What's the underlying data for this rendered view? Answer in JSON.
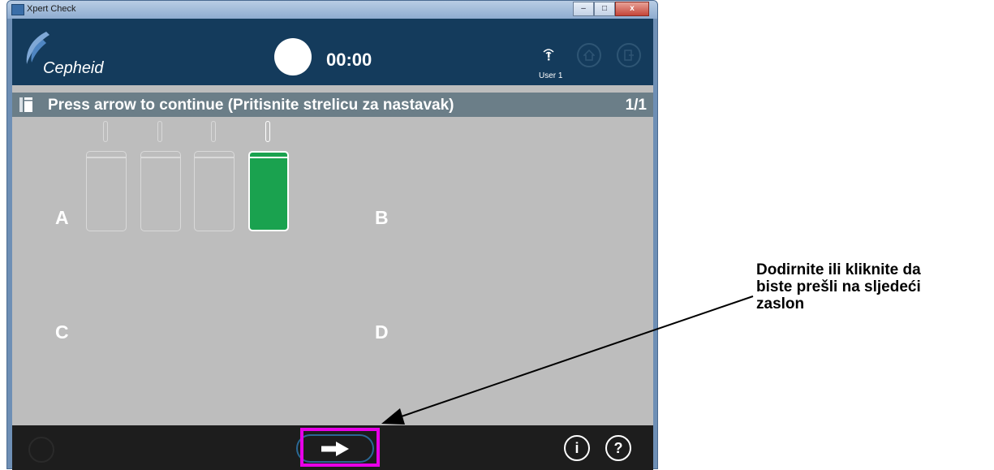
{
  "window": {
    "title": "Xpert Check",
    "minimize_label": "–",
    "maximize_label": "□",
    "close_label": "x"
  },
  "header": {
    "logo_text": "Cepheid",
    "timer": "00:00",
    "user_label": "User 1",
    "icons": [
      "wifi-warning-icon",
      "home-icon",
      "exit-icon"
    ]
  },
  "instruction": {
    "text": "Press arrow to continue (Pritisnite strelicu za nastavak)",
    "page_count": "1/1"
  },
  "modules": {
    "count": 4,
    "active_index": 4
  },
  "quadrants": {
    "a": "A",
    "b": "B",
    "c": "C",
    "d": "D"
  },
  "footer": {
    "info_label": "i",
    "help_label": "?"
  },
  "callout": {
    "line1": "Dodirnite ili kliknite da",
    "line2": "biste prešli na sljedeći",
    "line3": "zaslon"
  },
  "colors": {
    "header_bg": "#143b5c",
    "instruction_bar": "#6b7e88",
    "content_bg": "#bdbdbd",
    "active_module": "#1aa24f",
    "highlight": "#e800e8"
  }
}
